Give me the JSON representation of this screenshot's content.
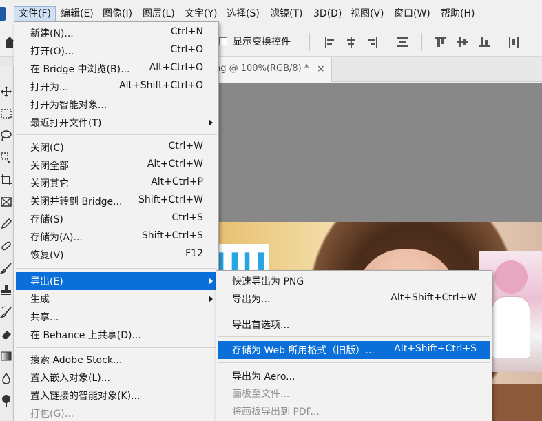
{
  "menubar": {
    "items": [
      "文件(F)",
      "编辑(E)",
      "图像(I)",
      "图层(L)",
      "文字(Y)",
      "选择(S)",
      "滤镜(T)",
      "3D(D)",
      "视图(V)",
      "窗口(W)",
      "帮助(H)"
    ]
  },
  "options_bar": {
    "show_transform_controls": "显示变换控件"
  },
  "tab": {
    "title": "ng @ 100%(RGB/8) *",
    "close": "×"
  },
  "file_menu": {
    "items": [
      {
        "label": "新建(N)...",
        "shortcut": "Ctrl+N"
      },
      {
        "label": "打开(O)...",
        "shortcut": "Ctrl+O"
      },
      {
        "label": "在 Bridge 中浏览(B)...",
        "shortcut": "Alt+Ctrl+O"
      },
      {
        "label": "打开为...",
        "shortcut": "Alt+Shift+Ctrl+O"
      },
      {
        "label": "打开为智能对象...",
        "shortcut": ""
      },
      {
        "label": "最近打开文件(T)",
        "shortcut": ""
      },
      {
        "label": "关闭(C)",
        "shortcut": "Ctrl+W"
      },
      {
        "label": "关闭全部",
        "shortcut": "Alt+Ctrl+W"
      },
      {
        "label": "关闭其它",
        "shortcut": "Alt+Ctrl+P"
      },
      {
        "label": "关闭并转到 Bridge...",
        "shortcut": "Shift+Ctrl+W"
      },
      {
        "label": "存储(S)",
        "shortcut": "Ctrl+S"
      },
      {
        "label": "存储为(A)...",
        "shortcut": "Shift+Ctrl+S"
      },
      {
        "label": "恢复(V)",
        "shortcut": "F12"
      },
      {
        "label": "导出(E)",
        "shortcut": ""
      },
      {
        "label": "生成",
        "shortcut": ""
      },
      {
        "label": "共享...",
        "shortcut": ""
      },
      {
        "label": "在 Behance 上共享(D)...",
        "shortcut": ""
      },
      {
        "label": "搜索 Adobe Stock...",
        "shortcut": ""
      },
      {
        "label": "置入嵌入对象(L)...",
        "shortcut": ""
      },
      {
        "label": "置入链接的智能对象(K)...",
        "shortcut": ""
      },
      {
        "label": "打包(G)...",
        "shortcut": ""
      }
    ]
  },
  "export_menu": {
    "items": [
      {
        "label": "快速导出为 PNG",
        "shortcut": ""
      },
      {
        "label": "导出为...",
        "shortcut": "Alt+Shift+Ctrl+W"
      },
      {
        "label": "导出首选项...",
        "shortcut": ""
      },
      {
        "label": "存储为 Web 所用格式（旧版）...",
        "shortcut": "Alt+Shift+Ctrl+S"
      },
      {
        "label": "导出为 Aero...",
        "shortcut": ""
      },
      {
        "label": "画板至文件...",
        "shortcut": ""
      },
      {
        "label": "将画板导出到 PDF...",
        "shortcut": ""
      }
    ]
  },
  "colors": {
    "highlight": "#0a6fd8",
    "canvas_bg": "#888888"
  }
}
